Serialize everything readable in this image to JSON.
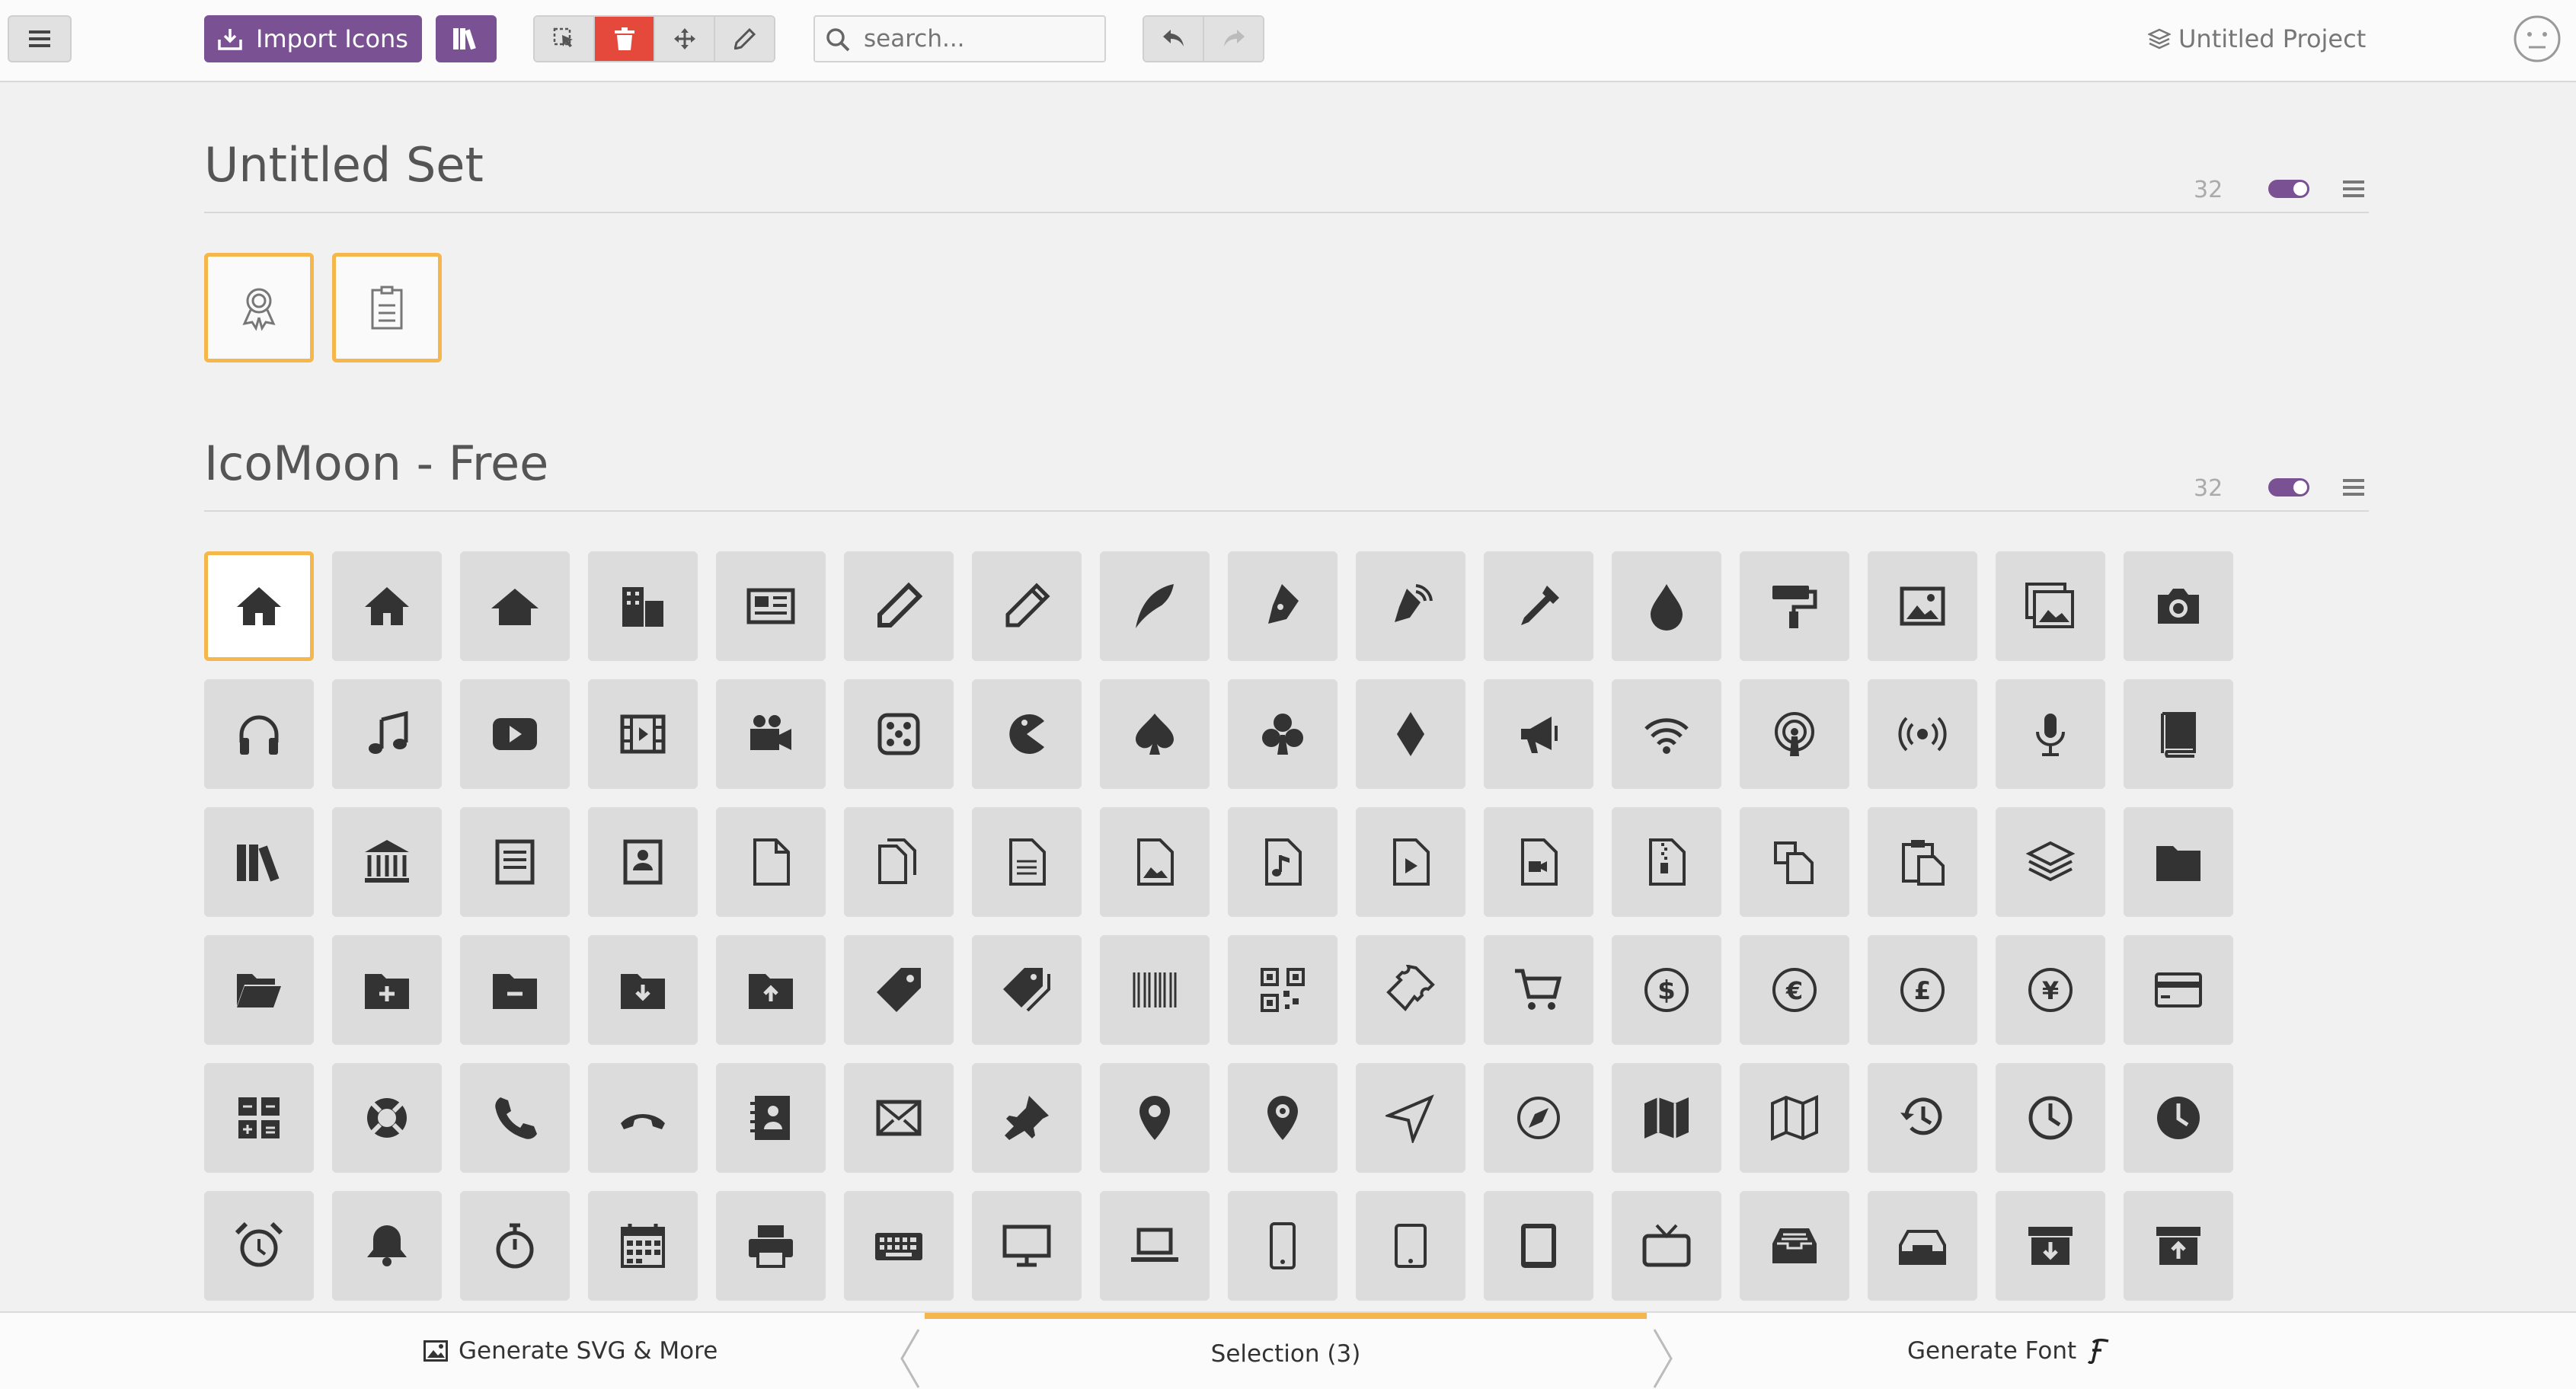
{
  "toolbar": {
    "import_label": "Import Icons",
    "search_placeholder": "search...",
    "project_label": "Untitled Project"
  },
  "sets": [
    {
      "title": "Untitled Set",
      "count": "32"
    },
    {
      "title": "IcoMoon - Free",
      "count": "32"
    }
  ],
  "bottombar": {
    "generate_svg_label": "Generate SVG & More",
    "selection_label": "Selection (3)",
    "generate_font_label": "Generate Font"
  },
  "colors": {
    "accent": "#7a5192",
    "selected_border": "#f5b74c",
    "delete": "#e4493b",
    "icon": "#333333"
  },
  "untitled_icons": [
    "award-icon",
    "clipboard-icon"
  ],
  "free_icons": [
    [
      "home-icon",
      "home2-icon",
      "home3-icon",
      "office-icon",
      "newspaper-icon",
      "pencil-icon",
      "pencil2-icon",
      "quill-icon",
      "pen-icon",
      "blog-icon",
      "eyedropper-icon",
      "droplet-icon",
      "paint-format-icon",
      "image-icon",
      "images-icon",
      "camera-icon"
    ],
    [
      "headphones-icon",
      "music-icon",
      "play-icon",
      "film-icon",
      "video-camera-icon",
      "dice-icon",
      "pacman-icon",
      "spades-icon",
      "clubs-icon",
      "diamonds-icon",
      "bullhorn-icon",
      "connection-icon",
      "podcast-icon",
      "feed-icon",
      "mic-icon",
      "book-icon"
    ],
    [
      "books-icon",
      "library-icon",
      "file-text-icon",
      "profile-icon",
      "file-empty-icon",
      "files-empty-icon",
      "file-text2-icon",
      "file-picture-icon",
      "file-music-icon",
      "file-play-icon",
      "file-video-icon",
      "file-zip-icon",
      "copy-icon",
      "paste-icon",
      "stack-icon",
      "folder-icon"
    ],
    [
      "folder-open-icon",
      "folder-plus-icon",
      "folder-minus-icon",
      "folder-download-icon",
      "folder-upload-icon",
      "price-tag-icon",
      "price-tags-icon",
      "barcode-icon",
      "qrcode-icon",
      "ticket-icon",
      "cart-icon",
      "coin-dollar-icon",
      "coin-euro-icon",
      "coin-pound-icon",
      "coin-yen-icon",
      "credit-card-icon"
    ],
    [
      "calculator-icon",
      "lifebuoy-icon",
      "phone-icon",
      "phone-hang-up-icon",
      "address-book-icon",
      "envelop-icon",
      "pushpin-icon",
      "location-icon",
      "location2-icon",
      "compass-icon",
      "compass2-icon",
      "map-icon",
      "map2-icon",
      "history-icon",
      "clock-icon",
      "clock2-icon"
    ],
    [
      "alarm-icon",
      "bell-icon",
      "stopwatch-icon",
      "calendar-icon",
      "printer-icon",
      "keyboard-icon",
      "display-icon",
      "laptop-icon",
      "mobile-icon",
      "mobile2-icon",
      "tablet-icon",
      "tv-icon",
      "drawer-icon",
      "drawer2-icon",
      "box-add-icon",
      "box-remove-icon"
    ]
  ]
}
